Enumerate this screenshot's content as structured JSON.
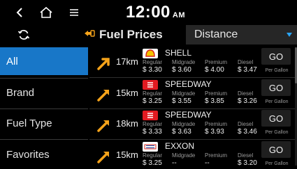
{
  "status": {
    "time": "12:00",
    "ampm": "AM"
  },
  "nav": {
    "back_icon": "back-arrow-icon",
    "home_icon": "home-icon",
    "menu_icon": "menu-icon"
  },
  "header": {
    "title": "Fuel Prices",
    "sort_value": "Distance"
  },
  "sidebar": {
    "items": [
      {
        "label": "All",
        "active": true
      },
      {
        "label": "Brand",
        "active": false
      },
      {
        "label": "Fuel Type",
        "active": false
      },
      {
        "label": "Favorites",
        "active": false
      }
    ]
  },
  "stations": [
    {
      "brand": "SHELL",
      "distance": "17km",
      "regular": "$ 3.30",
      "midgrade": "$ 3.60",
      "premium": "$ 4.00",
      "diesel": "$ 3.47",
      "logo": "shell-logo"
    },
    {
      "brand": "SPEEDWAY",
      "distance": "15km",
      "regular": "$ 3.25",
      "midgrade": "$ 3.55",
      "premium": "$ 3.85",
      "diesel": "$ 3.26",
      "logo": "speedway-logo"
    },
    {
      "brand": "SPEEDWAY",
      "distance": "18km",
      "regular": "$ 3.33",
      "midgrade": "$ 3.63",
      "premium": "$ 3.93",
      "diesel": "$ 3.46",
      "logo": "speedway-logo"
    },
    {
      "brand": "EXXON",
      "distance": "15km",
      "regular": "$ 3.25",
      "midgrade": "--",
      "premium": "--",
      "diesel": "$ 3.20",
      "logo": "exxon-logo"
    }
  ],
  "labels": {
    "regular": "Regular",
    "midgrade": "Midgrade",
    "premium": "Premium",
    "diesel": "Diesel",
    "go": "GO",
    "per_gallon": "Per Gallon"
  },
  "colors": {
    "accent": "#1877c8",
    "arrow": "#f5a31a",
    "caret": "#2aa4f4"
  }
}
